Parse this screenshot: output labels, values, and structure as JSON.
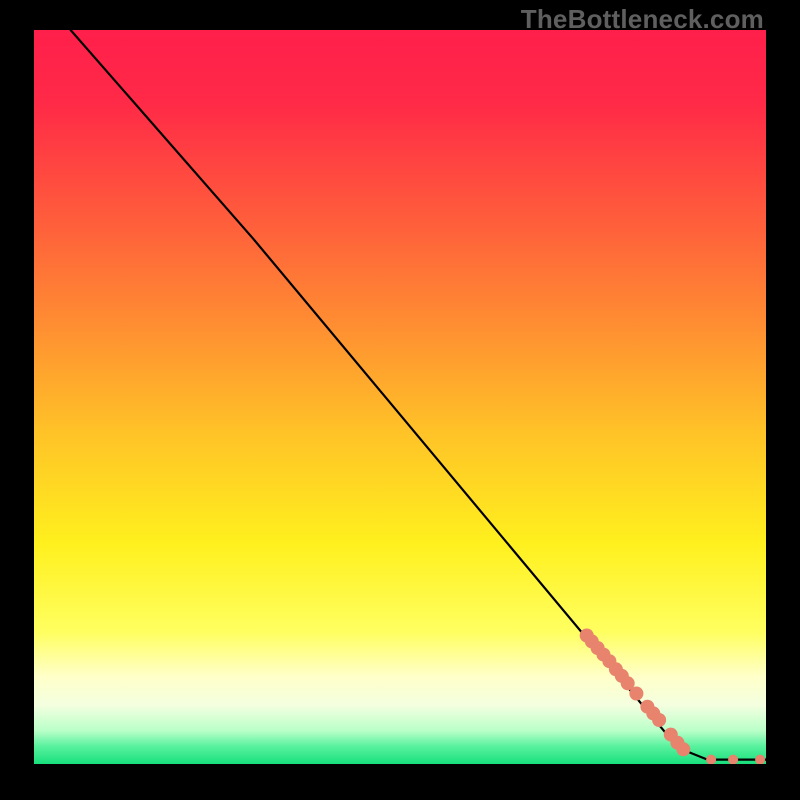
{
  "watermark": "TheBottleneck.com",
  "chart_data": {
    "type": "line",
    "title": "",
    "xlabel": "",
    "ylabel": "",
    "xlim": [
      0,
      100
    ],
    "ylim": [
      0,
      100
    ],
    "gradient_stops": [
      {
        "offset": 0.0,
        "color": "#ff1f4b"
      },
      {
        "offset": 0.1,
        "color": "#ff2a47"
      },
      {
        "offset": 0.25,
        "color": "#ff5a3c"
      },
      {
        "offset": 0.4,
        "color": "#ff8d32"
      },
      {
        "offset": 0.55,
        "color": "#ffc327"
      },
      {
        "offset": 0.7,
        "color": "#fff01e"
      },
      {
        "offset": 0.82,
        "color": "#ffff60"
      },
      {
        "offset": 0.88,
        "color": "#ffffc8"
      },
      {
        "offset": 0.92,
        "color": "#f4ffe0"
      },
      {
        "offset": 0.955,
        "color": "#b8ffc8"
      },
      {
        "offset": 0.975,
        "color": "#5cf2a0"
      },
      {
        "offset": 1.0,
        "color": "#17e07b"
      }
    ],
    "curve": [
      {
        "x": 5.0,
        "y": 100.0
      },
      {
        "x": 30.0,
        "y": 71.5
      },
      {
        "x": 88.0,
        "y": 2.2
      },
      {
        "x": 92.0,
        "y": 0.6
      },
      {
        "x": 100.0,
        "y": 0.6
      }
    ],
    "markers": {
      "color": "#e8836d",
      "radius": 7,
      "radius_small": 5,
      "points": [
        {
          "x": 75.5,
          "y": 17.5,
          "r": 7
        },
        {
          "x": 76.2,
          "y": 16.7,
          "r": 7
        },
        {
          "x": 77.0,
          "y": 15.8,
          "r": 7
        },
        {
          "x": 77.8,
          "y": 14.9,
          "r": 7
        },
        {
          "x": 78.6,
          "y": 14.0,
          "r": 7
        },
        {
          "x": 79.5,
          "y": 12.9,
          "r": 7
        },
        {
          "x": 80.3,
          "y": 12.0,
          "r": 7
        },
        {
          "x": 81.1,
          "y": 11.0,
          "r": 7
        },
        {
          "x": 82.3,
          "y": 9.6,
          "r": 7
        },
        {
          "x": 83.8,
          "y": 7.8,
          "r": 7
        },
        {
          "x": 84.6,
          "y": 6.9,
          "r": 7
        },
        {
          "x": 85.4,
          "y": 6.0,
          "r": 7
        },
        {
          "x": 87.0,
          "y": 4.0,
          "r": 7
        },
        {
          "x": 87.9,
          "y": 2.9,
          "r": 7
        },
        {
          "x": 88.7,
          "y": 2.0,
          "r": 7
        },
        {
          "x": 92.5,
          "y": 0.6,
          "r": 5
        },
        {
          "x": 95.5,
          "y": 0.6,
          "r": 5
        },
        {
          "x": 99.2,
          "y": 0.6,
          "r": 5
        }
      ]
    }
  }
}
